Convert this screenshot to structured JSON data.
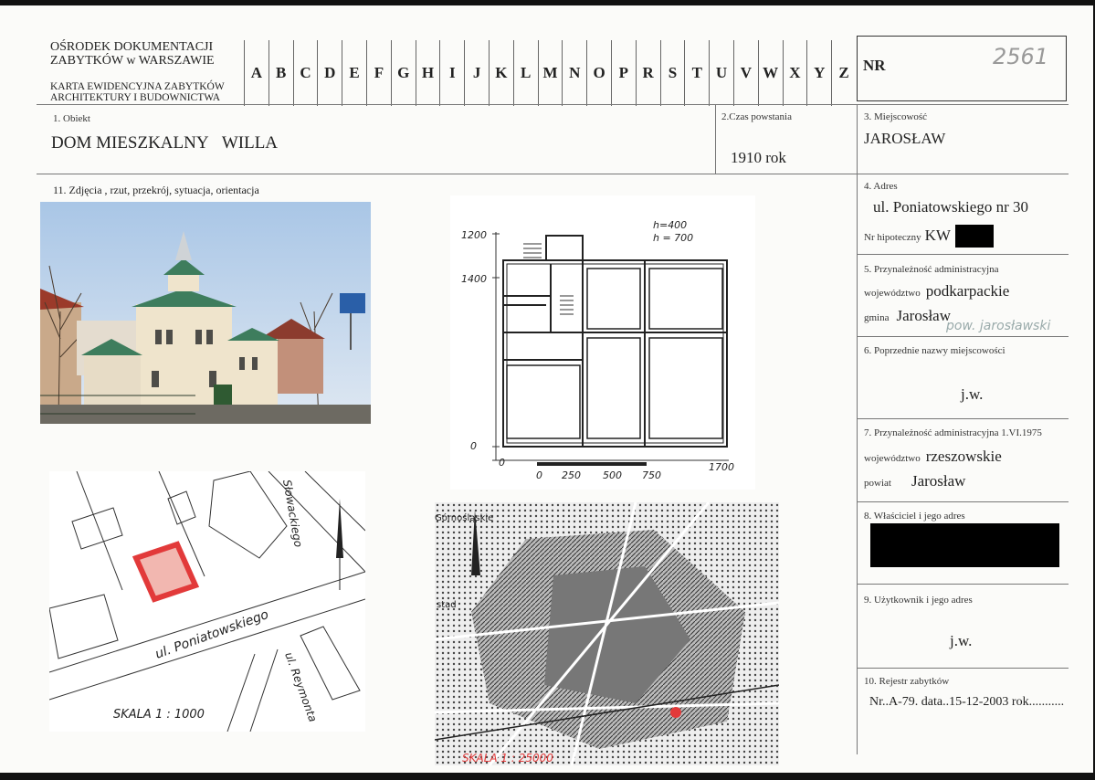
{
  "header": {
    "org_line1": "OŚRODEK DOKUMENTACJI",
    "org_line2": "ZABYTKÓW w WARSZAWIE",
    "card_line1": "KARTA EWIDENCYJNA ZABYTKÓW",
    "card_line2": "ARCHITEKTURY I BUDOWNICTWA",
    "letters": [
      "A",
      "B",
      "C",
      "D",
      "E",
      "F",
      "G",
      "H",
      "I",
      "J",
      "K",
      "L",
      "M",
      "N",
      "O",
      "P",
      "R",
      "S",
      "T",
      "U",
      "V",
      "W",
      "X",
      "Y",
      "Z"
    ],
    "nr_label": "NR",
    "nr_value": "2561"
  },
  "obiekt": {
    "label": "1. Obiekt",
    "value1": "DOM MIESZKALNY",
    "value2": "WILLA"
  },
  "czas": {
    "label": "2.Czas powstania",
    "value": "1910 rok"
  },
  "miejscowosc": {
    "label": "3. Miejscowość",
    "value": "JAROSŁAW"
  },
  "adres": {
    "label": "4. Adres",
    "value": "ul. Poniatowskiego nr 30",
    "hip_label": "Nr hipoteczny",
    "hip_value": "KW"
  },
  "przynaleznosc": {
    "label": "5. Przynależność administracyjna",
    "woj_label": "województwo",
    "woj_value": "podkarpackie",
    "gmina_label": "gmina",
    "gmina_value": "Jarosław",
    "gmina_note": "pow. jarosławski"
  },
  "poprzednie": {
    "label": "6. Poprzednie nazwy miejscowości",
    "value": "j.w."
  },
  "przynaleznosc1975": {
    "label": "7. Przynależność administracyjna 1.VI.1975",
    "woj_label": "województwo",
    "woj_value": "rzeszowskie",
    "powiat_label": "powiat",
    "powiat_value": "Jarosław"
  },
  "wlasciciel": {
    "label": "8. Właściciel i jego adres"
  },
  "uzytkownik": {
    "label": "9. Użytkownik i jego adres",
    "value": "j.w."
  },
  "rejestr": {
    "label": "10. Rejestr zabytków",
    "value": "Nr..A-79. data..15-12-2003 rok..........."
  },
  "zdjecia": {
    "label": "11. Zdjęcia , rzut, przekrój, sytuacja, orientacja"
  },
  "plan": {
    "h1": "h=400",
    "h2": "h = 700",
    "y_top": "1200",
    "y_mid": "1400",
    "y_zero": "0",
    "x_zero": "0",
    "x_end": "1700",
    "scale": [
      "0",
      "250",
      "500",
      "750"
    ]
  },
  "map1": {
    "street1": "ul. Poniatowskiego",
    "street2": "ul. Reymonta",
    "street3": "Słowackiego",
    "scale": "SKALA 1 : 1000"
  },
  "map2": {
    "top_text": "Górnośląskie",
    "stad": "stad",
    "scale": "SKALA 1 : 25000"
  },
  "colors": {
    "redmark": "#e23a3a",
    "redact": "#000000"
  }
}
